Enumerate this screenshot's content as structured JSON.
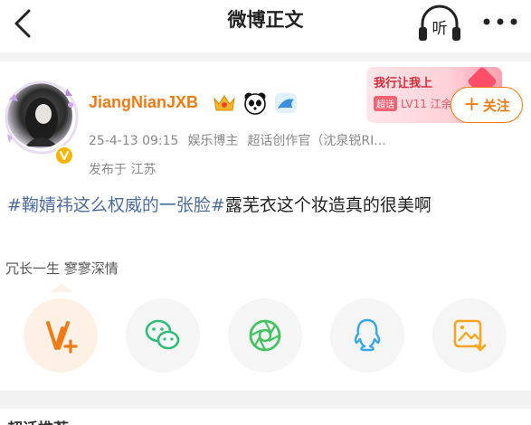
{
  "nav": {
    "title": "微博正文",
    "icons": {
      "back": "back-arrow-icon",
      "listen": "headphones-listen-icon",
      "more": "more-dots-icon"
    },
    "listen_glyph": "听"
  },
  "post": {
    "author": {
      "name": "JiangNianJXB",
      "avatar": "avatar-photo",
      "verified": true,
      "badges": [
        "crown-badge-icon",
        "panda-badge-icon",
        "shark-badge-icon"
      ]
    },
    "meta": {
      "time": "25-4-13 09:15",
      "role": "娱乐博主",
      "role2": "超话创作官（沈泉锐RI..."
    },
    "location": "发布于 江苏",
    "promo": {
      "title": "我行让我上",
      "chip": "超话",
      "sub": "LV11 江余"
    },
    "follow_label": "关注",
    "content": {
      "hashtag": "#鞠婧祎这么权威的一张脸#",
      "text": "露芜衣这个妆造真的很美啊"
    },
    "topic": "冗长一生 寥寥深情"
  },
  "share": [
    {
      "name": "share-vplus-icon",
      "bg": "#fdf1e6"
    },
    {
      "name": "share-wechat-icon",
      "bg": "#f5f5f5"
    },
    {
      "name": "share-moments-icon",
      "bg": "#f5f5f5"
    },
    {
      "name": "share-qq-icon",
      "bg": "#f5f5f5"
    },
    {
      "name": "share-save-image-icon",
      "bg": "#f5f5f5"
    }
  ],
  "colors": {
    "accent": "#f07a13",
    "hashtag": "#4d6d9e",
    "wechat": "#2dbd76",
    "moments": "#43c35f",
    "qq": "#38a7e8",
    "save": "#f5a623"
  },
  "next_section": {
    "title": "超话推荐"
  }
}
